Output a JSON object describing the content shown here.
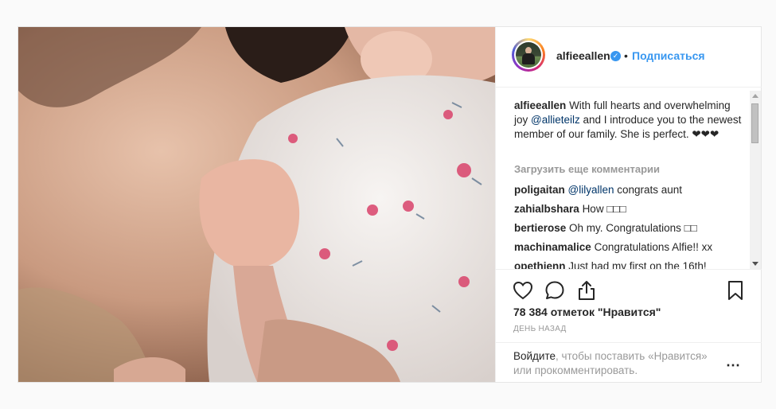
{
  "post": {
    "username": "alfieeallen",
    "verified_icon": "verified-badge-icon",
    "separator": "•",
    "follow_label": "Подписаться",
    "caption": {
      "username": "alfieeallen",
      "text_before": "With full hearts and overwhelming joy ",
      "mention": "@allieteilz",
      "text_after": " and I introduce you to the newest member of our family. She is perfect. ❤❤❤"
    },
    "load_more": "Загрузить еще комментарии",
    "comments": [
      {
        "user": "poligaitan",
        "mention": "@lilyallen",
        "text": " congrats aunt"
      },
      {
        "user": "zahialbshara",
        "mention": "",
        "text": "How □□□"
      },
      {
        "user": "bertierose",
        "mention": "",
        "text": "Oh my. Congratulations □□"
      },
      {
        "user": "machinamalice",
        "mention": "",
        "text": "Congratulations Alfie!! xx"
      },
      {
        "user": "opethjenn",
        "mention": "",
        "text": "Just had my first on the 16th!"
      }
    ],
    "likes": "78 384 отметок \"Нравится\"",
    "timestamp": "день назад",
    "login": {
      "link": "Войдите",
      "text": ", чтобы поставить «Нравится» или прокомментировать."
    },
    "more_icon": "⋯"
  },
  "colors": {
    "link_blue": "#3897f0",
    "mention_blue": "#003569",
    "muted": "#999999"
  }
}
